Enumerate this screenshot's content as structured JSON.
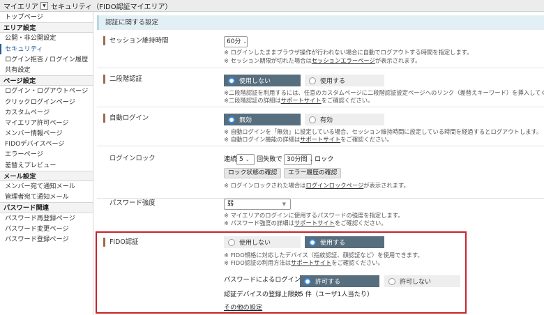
{
  "topbar": {
    "crumb1": "マイエリア",
    "crumb2": "セキュリティ（FIDO認証マイエリア）"
  },
  "sidebar": {
    "items": [
      {
        "text": "トップページ",
        "kind": "item"
      },
      {
        "text": "エリア設定",
        "kind": "section"
      },
      {
        "text": "公開・非公開設定",
        "kind": "item"
      },
      {
        "text": "セキュリティ",
        "kind": "item",
        "active": true
      },
      {
        "text": "ログイン拒否 / ログイン履歴",
        "kind": "item"
      },
      {
        "text": "共有設定",
        "kind": "item"
      },
      {
        "text": "ページ設定",
        "kind": "section"
      },
      {
        "text": "ログイン・ログアウトページ",
        "kind": "item"
      },
      {
        "text": "クリックログインページ",
        "kind": "item"
      },
      {
        "text": "カスタムページ",
        "kind": "item"
      },
      {
        "text": "マイエリア許可ページ",
        "kind": "item"
      },
      {
        "text": "メンバー情報ページ",
        "kind": "item"
      },
      {
        "text": "FIDOデバイスページ",
        "kind": "item"
      },
      {
        "text": "エラーページ",
        "kind": "item"
      },
      {
        "text": "差替えプレビュー",
        "kind": "item"
      },
      {
        "text": "メール設定",
        "kind": "section"
      },
      {
        "text": "メンバー宛て通知メール",
        "kind": "item"
      },
      {
        "text": "管理者宛て通知メール",
        "kind": "item"
      },
      {
        "text": "パスワード関連",
        "kind": "section"
      },
      {
        "text": "パスワード再登録ページ",
        "kind": "item"
      },
      {
        "text": "パスワード変更ページ",
        "kind": "item"
      },
      {
        "text": "パスワード登録ページ",
        "kind": "item"
      }
    ]
  },
  "main": {
    "section_title": "認証に関する設定",
    "session": {
      "label": "セッション維持時間",
      "value": "60分",
      "note1": "※ ログインしたままブラウザ操作が行われない場合に自動でログアウトする時間を指定します。",
      "note2_pre": "※ セッション期限が切れた場合は",
      "note2_link": "セッションエラーページ",
      "note2_post": "が表示されます。"
    },
    "twofactor": {
      "label": "二段階認証",
      "opt_off": "使用しない",
      "opt_on": "使用する",
      "note1": "※二段階認証を利用するには、任意のカスタムページに二段階認証設定ページへのリンク（差替えキーワード）を挿入してください。",
      "note2_pre": "※二段階認証の詳細は",
      "note2_link": "サポートサイト",
      "note2_post": "をご確認ください。"
    },
    "autologin": {
      "label": "自動ログイン",
      "opt_off": "無効",
      "opt_on": "有効",
      "note1": "※ 自動ログインを「無効」に設定している場合、セッション維持時間に設定している時間を経過するとログアウトします。",
      "note2_pre": "※ 自動ログイン機能の詳細は",
      "note2_link": "サポートサイト",
      "note2_post": "をご確認ください。"
    },
    "lock": {
      "label": "ログインロック",
      "prefix": "連続",
      "count": "5",
      "mid": "回失敗で",
      "duration": "30分間",
      "suffix": "ロック",
      "btn_status": "ロック状態の確認",
      "btn_errors": "エラー履歴の確認",
      "note_pre": "※ ログインロックされた場合は",
      "note_link": "ログインロックページ",
      "note_post": "が表示されます。"
    },
    "strength": {
      "label": "パスワード強度",
      "value": "弱",
      "note1": "※ マイエリアのログインに使用するパスワードの強度を指定します。",
      "note2_pre": "※ パスワード強度の詳細は",
      "note2_link": "サポートサイト",
      "note2_post": "をご確認ください。"
    },
    "fido": {
      "label": "FIDO認証",
      "opt_off": "使用しない",
      "opt_on": "使用する",
      "note1": "※ FIDO規格に対応したデバイス（指紋認証、顔認証など）を使用できます。",
      "note2_pre": "※ FIDO認証の利用方法は",
      "note2_link": "サポートサイト",
      "note2_post": "をご確認ください。",
      "pw_login_label": "パスワードによるログイン",
      "pw_allow": "許可する",
      "pw_deny": "許可しない",
      "device_limit_label": "認証デバイスの登録上限数",
      "device_limit_value": "5 件（ユーザ1人当たり）",
      "other_settings": "その他の設定"
    }
  },
  "colors": {
    "accent_radio": "#576e7e",
    "highlight_border": "#c8232a",
    "label_marker": "#9b6b4e",
    "header_bg": "#e2f0f6"
  }
}
